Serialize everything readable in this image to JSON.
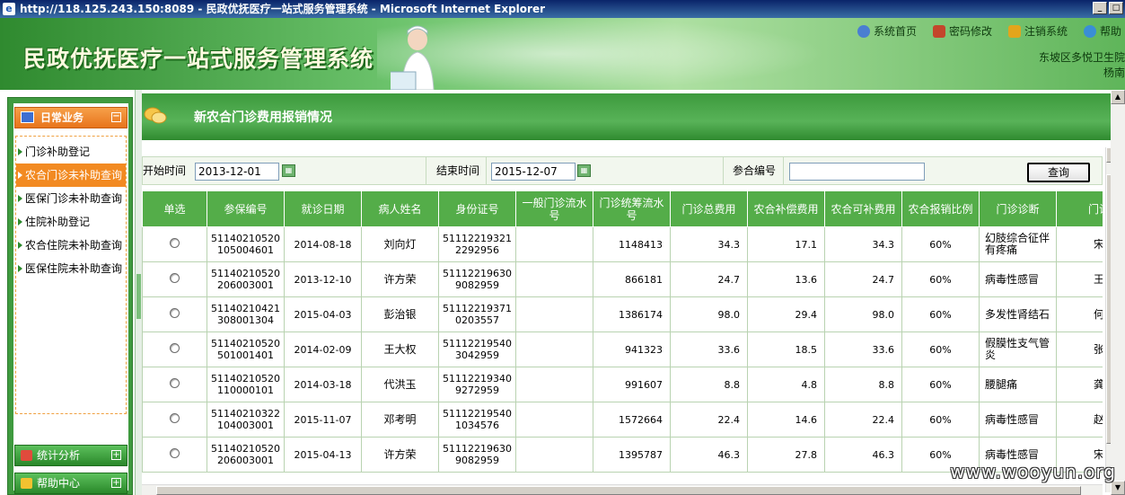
{
  "window": {
    "title": "http://118.125.243.150:8089 - 民政优抚医疗一站式服务管理系统 - Microsoft Internet Explorer"
  },
  "header": {
    "system_title": "民政优抚医疗一站式服务管理系统",
    "links": [
      {
        "label": "系统首页",
        "icon": "globe-icon",
        "color": "#4a7fd1"
      },
      {
        "label": "密码修改",
        "icon": "key-icon",
        "color": "#c4462b"
      },
      {
        "label": "注销系统",
        "icon": "logout-icon",
        "color": "#e3a51c"
      },
      {
        "label": "帮助",
        "icon": "help-icon",
        "color": "#3a8ed6"
      }
    ],
    "user_line1": "东坡区多悦卫生院",
    "user_line2": "杨南"
  },
  "sidebar": {
    "section_title": "日常业务",
    "items": [
      {
        "label": "门诊补助登记",
        "active": false
      },
      {
        "label": "农合门诊未补助查询",
        "active": true
      },
      {
        "label": "医保门诊未补助查询",
        "active": false
      },
      {
        "label": "住院补助登记",
        "active": false
      },
      {
        "label": "农合住院未补助查询",
        "active": false
      },
      {
        "label": "医保住院未补助查询",
        "active": false
      }
    ],
    "footer": [
      {
        "label": "统计分析",
        "icon": "chart-icon"
      },
      {
        "label": "帮助中心",
        "icon": "book-icon"
      }
    ]
  },
  "panel": {
    "title": "新农合门诊费用报销情况"
  },
  "filter": {
    "start_label": "开始时间",
    "start_value": "2013-12-01",
    "end_label": "结束时间",
    "end_value": "2015-12-07",
    "id_label": "参合编号",
    "id_value": "",
    "query_button": "查询"
  },
  "table": {
    "headers": [
      "单选",
      "参保编号",
      "就诊日期",
      "病人姓名",
      "身份证号",
      "一般门诊流水号",
      "门诊统筹流水号",
      "门诊总费用",
      "农合补偿费用",
      "农合可补费用",
      "农合报销比例",
      "门诊诊断",
      "门诊医"
    ],
    "rows": [
      {
        "insure_no": "51140210520105004601",
        "date": "2014-08-18",
        "name": "刘向灯",
        "id_no": "511122193212292956",
        "general_no": "",
        "pool_no": "1148413",
        "total": "34.3",
        "compensate": "17.1",
        "allowable": "34.3",
        "ratio": "60%",
        "diagnosis": "幻肢综合征伴有疼痛",
        "doctor": "宋学"
      },
      {
        "insure_no": "51140210520206003001",
        "date": "2013-12-10",
        "name": "许方荣",
        "id_no": "511122196309082959",
        "general_no": "",
        "pool_no": "866181",
        "total": "24.7",
        "compensate": "13.6",
        "allowable": "24.7",
        "ratio": "60%",
        "diagnosis": "病毒性感冒",
        "doctor": "王翻"
      },
      {
        "insure_no": "51140210421308001304",
        "date": "2015-04-03",
        "name": "彭治银",
        "id_no": "511122193710203557",
        "general_no": "",
        "pool_no": "1386174",
        "total": "98.0",
        "compensate": "29.4",
        "allowable": "98.0",
        "ratio": "60%",
        "diagnosis": "多发性肾结石",
        "doctor": "何兴"
      },
      {
        "insure_no": "51140210520501001401",
        "date": "2014-02-09",
        "name": "王大权",
        "id_no": "511122195403042959",
        "general_no": "",
        "pool_no": "941323",
        "total": "33.6",
        "compensate": "18.5",
        "allowable": "33.6",
        "ratio": "60%",
        "diagnosis": "假膜性支气管炎",
        "doctor": "张莲"
      },
      {
        "insure_no": "51140210520110000101",
        "date": "2014-03-18",
        "name": "代洪玉",
        "id_no": "511122193409272959",
        "general_no": "",
        "pool_no": "991607",
        "total": "8.8",
        "compensate": "4.8",
        "allowable": "8.8",
        "ratio": "60%",
        "diagnosis": "腰腿痛",
        "doctor": "龚志"
      },
      {
        "insure_no": "51140210322104003001",
        "date": "2015-11-07",
        "name": "邓考明",
        "id_no": "511122195401034576",
        "general_no": "",
        "pool_no": "1572664",
        "total": "22.4",
        "compensate": "14.6",
        "allowable": "22.4",
        "ratio": "60%",
        "diagnosis": "病毒性感冒",
        "doctor": "赵仁"
      },
      {
        "insure_no": "51140210520206003001",
        "date": "2015-04-13",
        "name": "许方荣",
        "id_no": "511122196309082959",
        "general_no": "",
        "pool_no": "1395787",
        "total": "46.3",
        "compensate": "27.8",
        "allowable": "46.3",
        "ratio": "60%",
        "diagnosis": "病毒性感冒",
        "doctor": "宋学"
      }
    ]
  },
  "watermark": "www.wooyun.org"
}
